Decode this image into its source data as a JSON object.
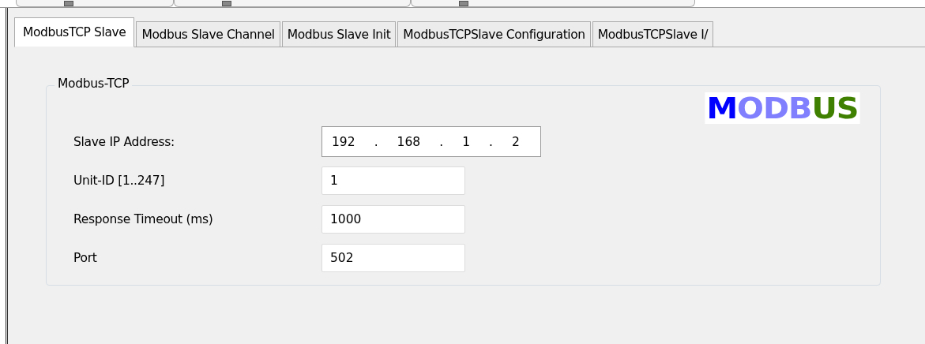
{
  "tabs": [
    {
      "label": "ModbusTCP Slave",
      "selected": true
    },
    {
      "label": "Modbus Slave Channel",
      "selected": false
    },
    {
      "label": "Modbus Slave Init",
      "selected": false
    },
    {
      "label": "ModbusTCPSlave Configuration",
      "selected": false
    },
    {
      "label": "ModbusTCPSlave I/",
      "selected": false
    }
  ],
  "group": {
    "title": "Modbus-TCP",
    "logo": [
      {
        "text": "M",
        "color": "#0000ff"
      },
      {
        "text": "ODB",
        "color": "#8080ff"
      },
      {
        "text": "US",
        "color": "#408000"
      }
    ],
    "fields": [
      {
        "kind": "ip",
        "label": "Slave IP Address:",
        "octets": [
          "192",
          "168",
          "1",
          "2"
        ],
        "separator": "."
      },
      {
        "kind": "text",
        "label": "Unit-ID [1..247]",
        "value": "1"
      },
      {
        "kind": "text",
        "label": "Response Timeout (ms)",
        "value": "1000"
      },
      {
        "kind": "text",
        "label": "Port",
        "value": "502"
      }
    ]
  }
}
